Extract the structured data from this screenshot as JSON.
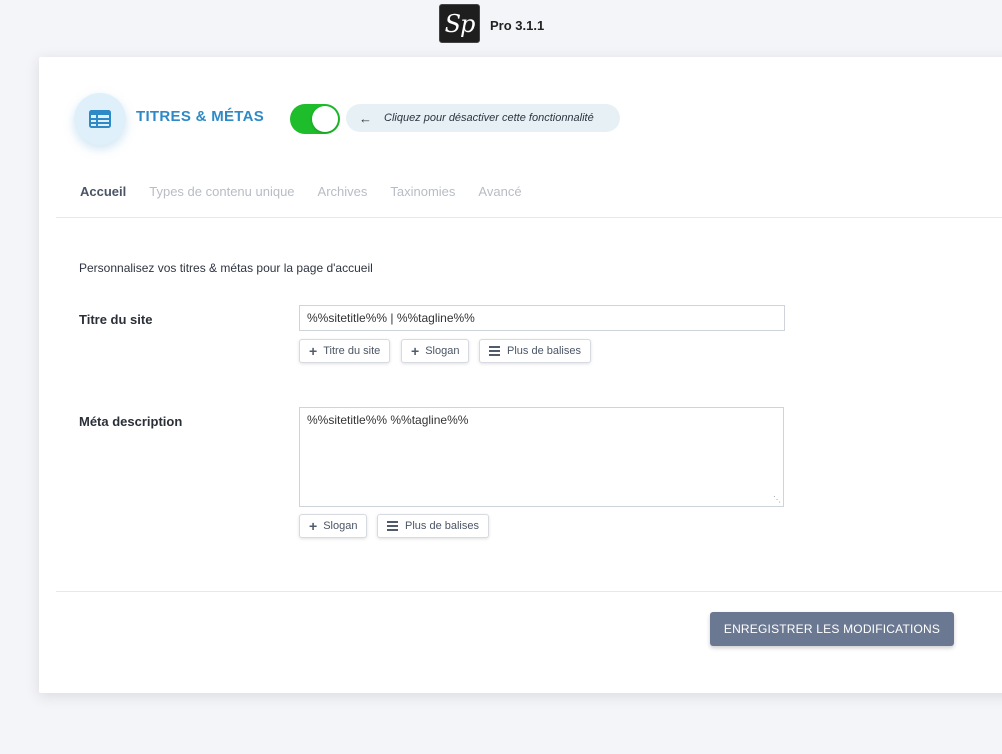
{
  "header": {
    "logo_text": "Sp",
    "version": "Pro 3.1.1"
  },
  "feature": {
    "icon": "table-icon",
    "title": "TITRES & MÉTAS",
    "toggle_on": true,
    "toggle_hint": "Cliquez pour désactiver cette fonctionnalité"
  },
  "tabs": [
    {
      "label": "Accueil",
      "active": true
    },
    {
      "label": "Types de contenu unique",
      "active": false
    },
    {
      "label": "Archives",
      "active": false
    },
    {
      "label": "Taxinomies",
      "active": false
    },
    {
      "label": "Avancé",
      "active": false
    }
  ],
  "intro": "Personnalisez vos titres & métas pour la page d'accueil",
  "site_title": {
    "label": "Titre du site",
    "value": "%%sitetitle%% | %%tagline%%",
    "buttons": [
      "Titre du site",
      "Slogan",
      "Plus de balises"
    ]
  },
  "meta_description": {
    "label": "Méta description",
    "value": "%%sitetitle%% %%tagline%%",
    "buttons": [
      "Slogan",
      "Plus de balises"
    ]
  },
  "save_label": "ENREGISTRER LES MODIFICATIONS",
  "colors": {
    "accent": "#2e8ac6",
    "toggle_on": "#1ebd2b",
    "save_button": "#6b7891"
  }
}
